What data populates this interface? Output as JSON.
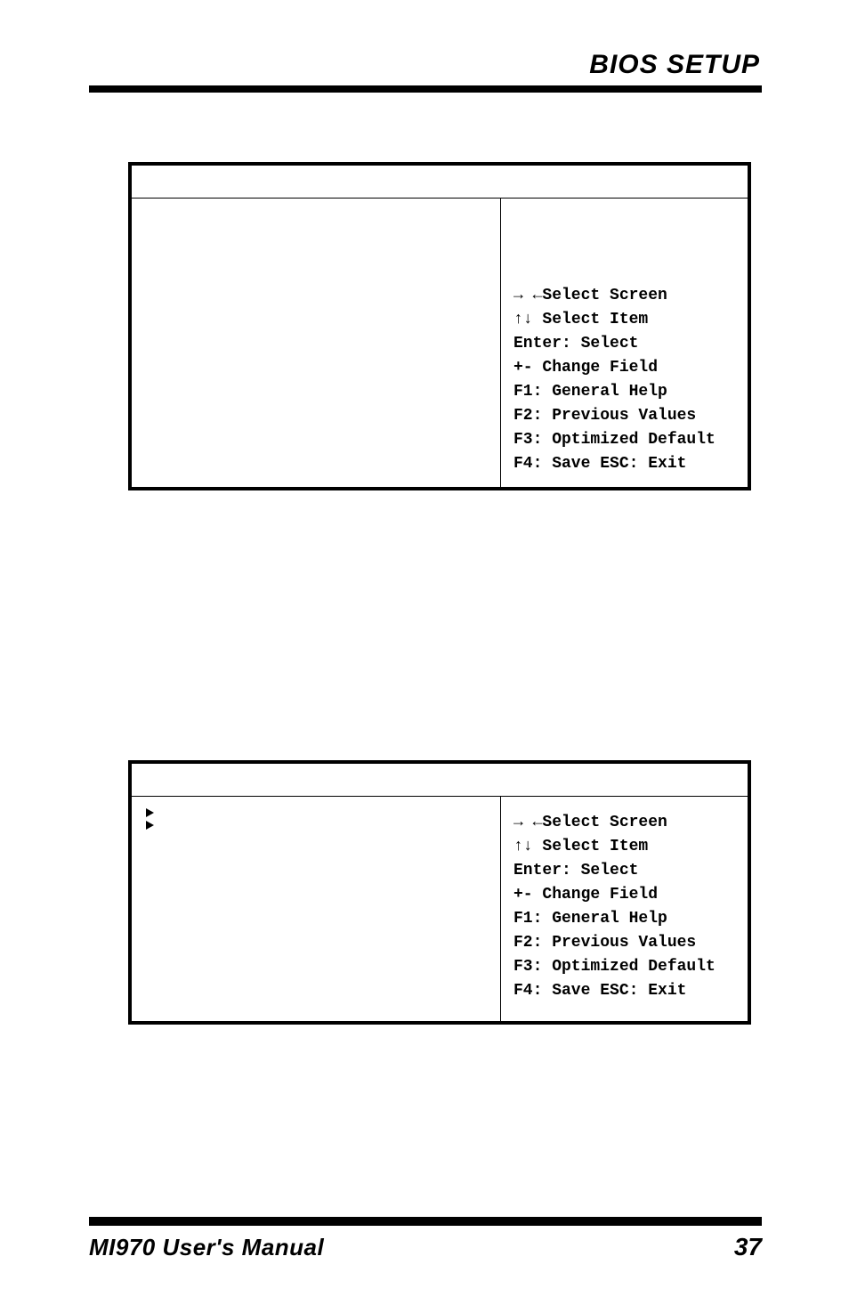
{
  "header": {
    "section_title": "BIOS SETUP"
  },
  "help_block": {
    "line1_prefix": "→ ←",
    "line1_label": "Select Screen",
    "line2_prefix": "↑↓",
    "line2_label": " Select Item",
    "enter": "Enter: Select",
    "change": "+-  Change Field",
    "f1": "F1: General Help",
    "f2": "F2: Previous Values",
    "f3": "F3: Optimized Default",
    "f4": "F4: Save  ESC: Exit"
  },
  "panel2": {
    "items": [
      "",
      ""
    ]
  },
  "footer": {
    "manual": "MI970 User's Manual",
    "page": "37"
  }
}
